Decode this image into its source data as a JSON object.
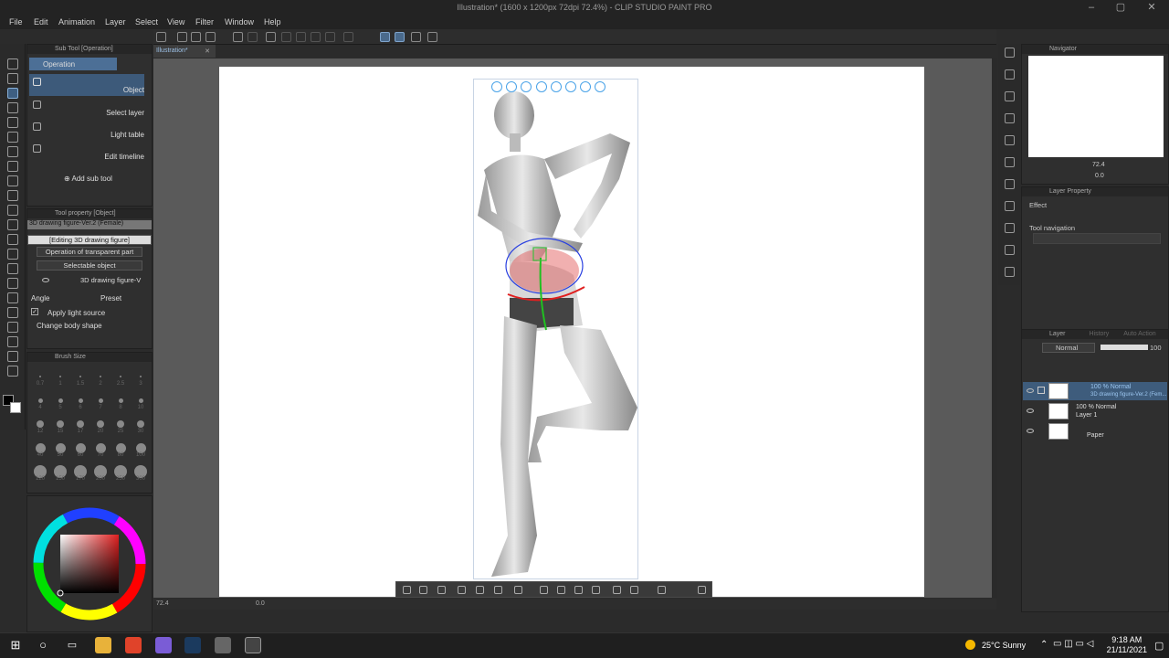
{
  "window": {
    "title": "Illustration* (1600 x 1200px 72dpi 72.4%) - CLIP STUDIO PAINT PRO",
    "canvas_tab": "Illustration*"
  },
  "menu": [
    "File",
    "Edit",
    "Animation",
    "Layer",
    "Select",
    "View",
    "Filter",
    "Window",
    "Help"
  ],
  "subtool_panel": {
    "header": "Sub Tool [Operation]",
    "tab": "Operation",
    "items": [
      "Object",
      "Select layer",
      "Light table",
      "Edit timeline"
    ],
    "add": "Add sub tool"
  },
  "tool_property": {
    "header": "Tool property [Object]",
    "figure_name": "3D drawing figure-Ver.2 (Female)",
    "editing_button": "[Editing 3D drawing figure]",
    "transparent_select": "Operation of transparent part",
    "selectable": "Selectable object",
    "object_row": "3D drawing figure-V",
    "angle": "Angle",
    "preset": "Preset",
    "apply_light": "Apply light source",
    "change_body": "Change body shape"
  },
  "brush_size": {
    "header": "Brush Size",
    "sizes": [
      "0.7",
      "1",
      "1.5",
      "2",
      "2.5",
      "3",
      "4",
      "5",
      "6",
      "7",
      "8",
      "10",
      "12",
      "15",
      "17",
      "20",
      "25",
      "30",
      "40",
      "50",
      "60",
      "70",
      "80",
      "100",
      "120",
      "150",
      "170",
      "200",
      "250",
      "300"
    ]
  },
  "navigator": {
    "header": "Navigator",
    "zoom": "72.4",
    "rotate": "0.0"
  },
  "layer_property": {
    "header": "Layer Property",
    "effect": "Effect",
    "tool_nav": "Tool navigation"
  },
  "layers": {
    "header": "Layer",
    "tabs": [
      "Layer",
      "History",
      "Auto Action"
    ],
    "blend": "Normal",
    "opacity": "100",
    "items": [
      {
        "mode": "100 % Normal",
        "name": "3D drawing figure-Ver.2 (Fem..."
      },
      {
        "mode": "100 % Normal",
        "name": "Layer 1"
      },
      {
        "mode": "",
        "name": "Paper"
      }
    ]
  },
  "status": {
    "zoom": "72.4",
    "rotation": "0.0"
  },
  "taskbar": {
    "weather": "25°C  Sunny",
    "time": "9:18 AM",
    "date": "21/11/2021"
  },
  "colors": {
    "accent": "#4a6a8c",
    "figure_highlight": "#e05050"
  }
}
